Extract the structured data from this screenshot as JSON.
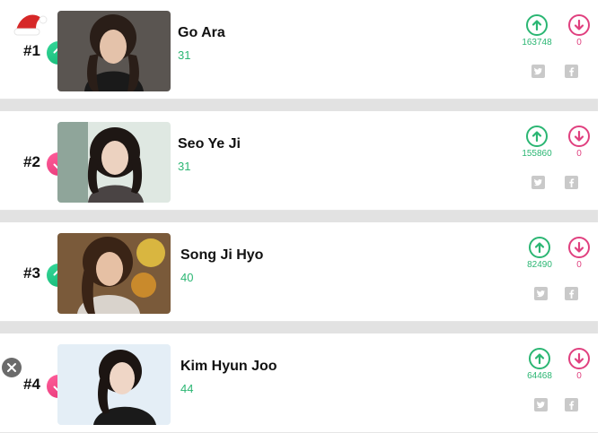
{
  "colors": {
    "accent_green": "#2bb673",
    "accent_pink": "#e0407f",
    "separator": "#e2e2e2",
    "icon_gray": "#c9c9c9"
  },
  "icons": {
    "rank_decoration": "santa-hat-icon",
    "trend_up": "arrow-up-icon",
    "trend_down": "arrow-down-icon",
    "vote_up": "circle-arrow-up-icon",
    "vote_down": "circle-arrow-down-icon",
    "share_twitter": "twitter-icon",
    "share_facebook": "facebook-icon",
    "close": "close-icon"
  },
  "rankings": [
    {
      "rank": "#1",
      "name": "Go Ara",
      "age": "31",
      "trend": "up",
      "votes_up": "163748",
      "votes_down": "0"
    },
    {
      "rank": "#2",
      "name": "Seo Ye Ji",
      "age": "31",
      "trend": "down",
      "votes_up": "155860",
      "votes_down": "0"
    },
    {
      "rank": "#3",
      "name": "Song Ji Hyo",
      "age": "40",
      "trend": "up",
      "votes_up": "82490",
      "votes_down": "0"
    },
    {
      "rank": "#4",
      "name": "Kim Hyun Joo",
      "age": "44",
      "trend": "down",
      "votes_up": "64468",
      "votes_down": "0"
    }
  ]
}
